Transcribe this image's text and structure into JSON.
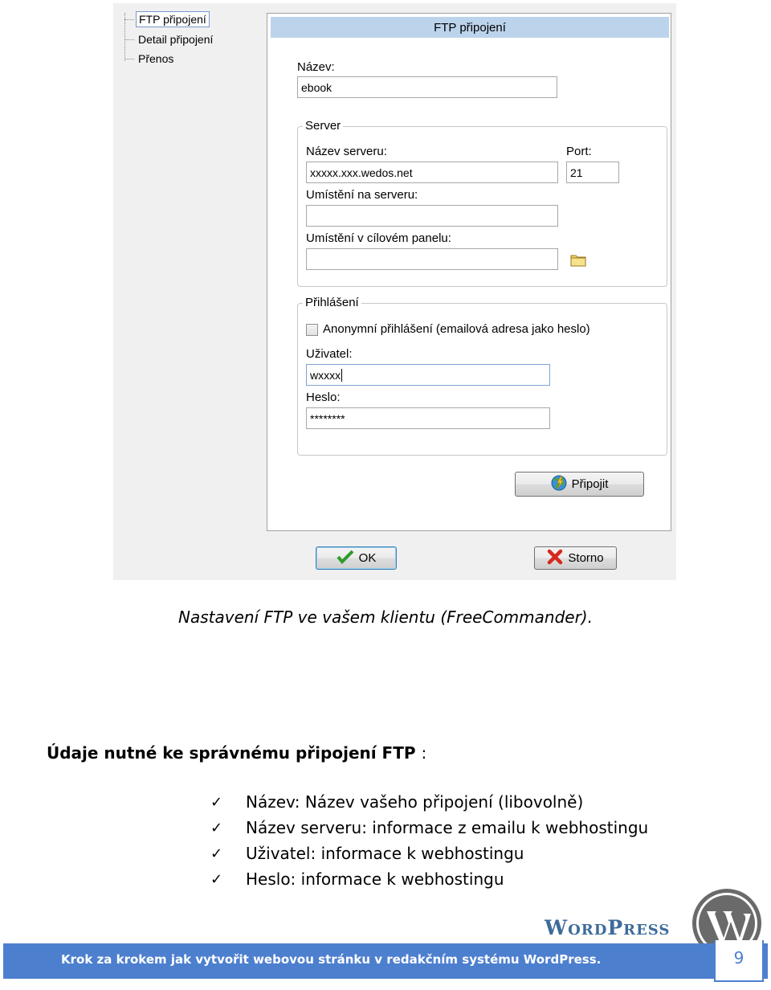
{
  "dialog": {
    "tree": [
      "FTP připojení",
      "Detail připojení",
      "Přenos"
    ],
    "panel_title": "FTP připojení",
    "name_label": "Název:",
    "name_value": "ebook",
    "server_group": "Server",
    "server_name_label": "Název serveru:",
    "server_name_value": "xxxxx.xxx.wedos.net",
    "port_label": "Port:",
    "port_value": "21",
    "server_location_label": "Umístění na serveru:",
    "server_location_value": "",
    "target_panel_label": "Umístění v cílovém panelu:",
    "target_panel_value": "",
    "login_group": "Přihlášení",
    "anonymous_label": "Anonymní přihlášení (emailová adresa jako heslo)",
    "user_label": "Uživatel:",
    "user_value": "wxxxx",
    "password_label": "Heslo:",
    "password_value": "********",
    "connect_button": "Připojit",
    "ok_button": "OK",
    "cancel_button": "Storno"
  },
  "caption": "Nastavení FTP ve vašem klientu (FreeCommander).",
  "heading": "Údaje nutné ke správnému připojení FTP",
  "heading_colon": ":",
  "bullets": [
    "Název: Název vašeho připojení (libovolně)",
    "Název serveru: informace z emailu k webhostingu",
    "Uživatel: informace k webhostingu",
    "Heslo: informace k webhostingu"
  ],
  "logo_text": "WordPress",
  "footer": {
    "text": "Krok za krokem jak vytvořit webovou stránku v redakčním systému WordPress.",
    "page_number": "9"
  }
}
